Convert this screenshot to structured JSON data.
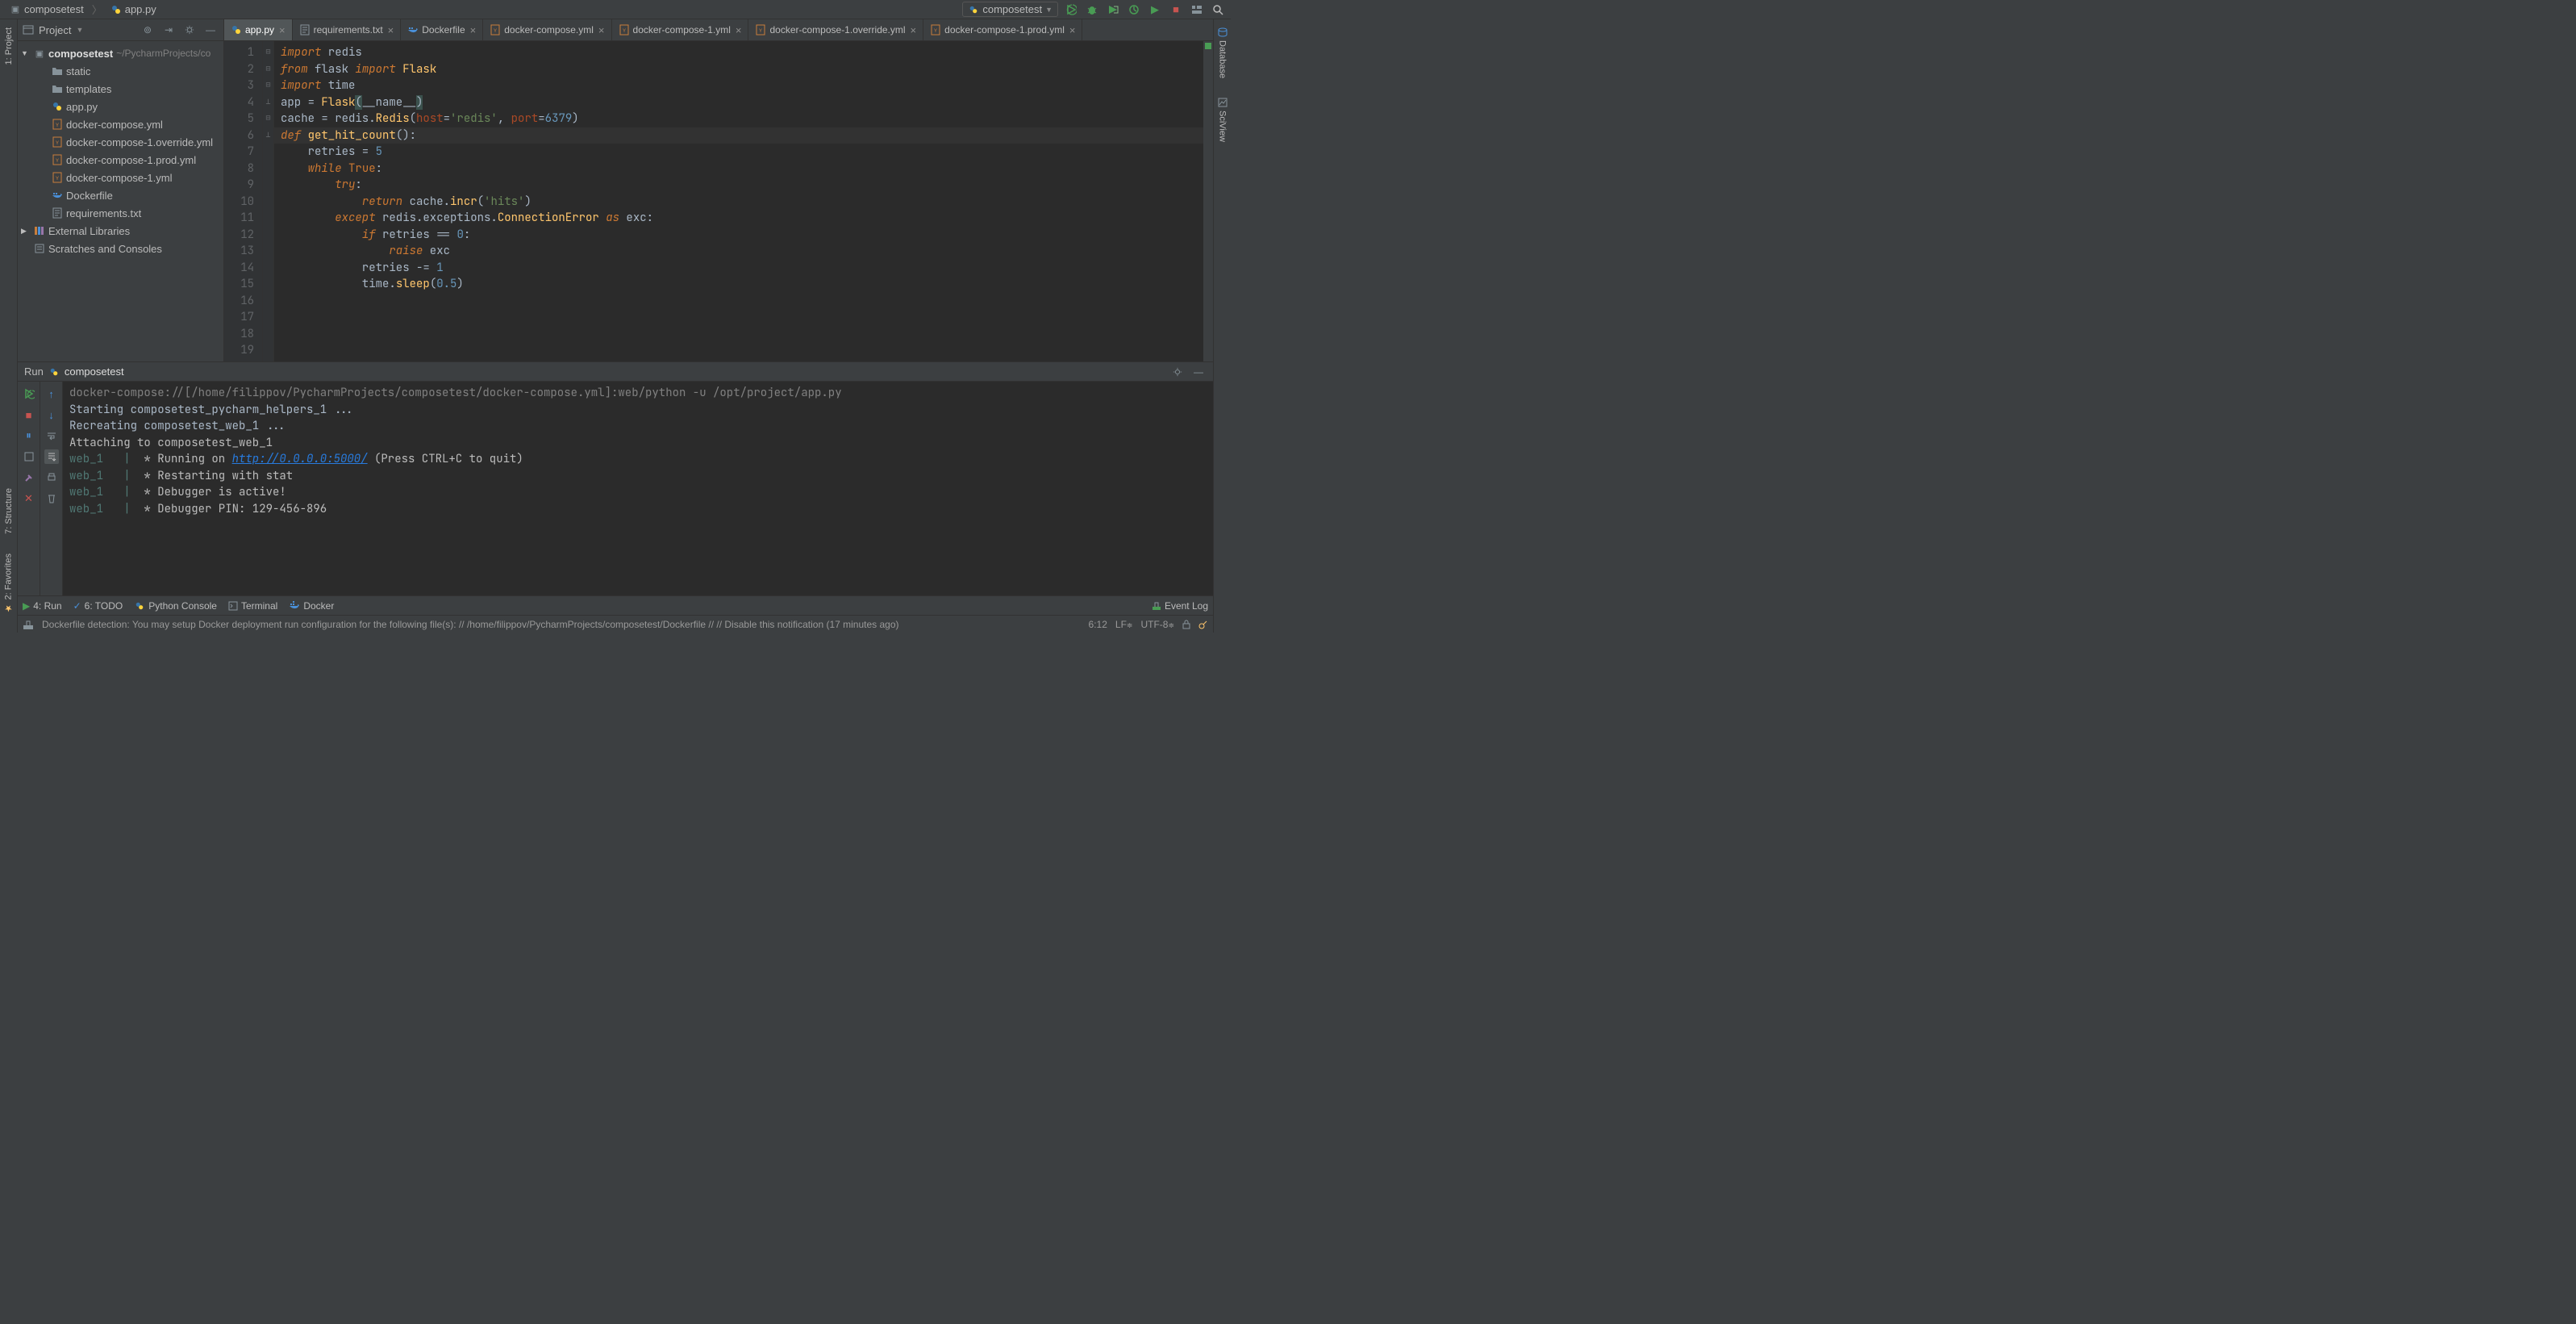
{
  "breadcrumb": {
    "project": "composetest",
    "file": "app.py"
  },
  "run_config_name": "composetest",
  "project_tool": {
    "title": "Project",
    "root": {
      "name": "composetest",
      "path": "~/PycharmProjects/co"
    },
    "items": [
      {
        "name": "static",
        "type": "folder"
      },
      {
        "name": "templates",
        "type": "folder"
      },
      {
        "name": "app.py",
        "type": "py"
      },
      {
        "name": "docker-compose.yml",
        "type": "yaml"
      },
      {
        "name": "docker-compose-1.override.yml",
        "type": "yaml"
      },
      {
        "name": "docker-compose-1.prod.yml",
        "type": "yaml"
      },
      {
        "name": "docker-compose-1.yml",
        "type": "yaml"
      },
      {
        "name": "Dockerfile",
        "type": "docker"
      },
      {
        "name": "requirements.txt",
        "type": "txt"
      }
    ],
    "external": "External Libraries",
    "scratches": "Scratches and Consoles"
  },
  "tabs": [
    {
      "label": "app.py",
      "type": "py",
      "active": true
    },
    {
      "label": "requirements.txt",
      "type": "txt"
    },
    {
      "label": "Dockerfile",
      "type": "docker"
    },
    {
      "label": "docker-compose.yml",
      "type": "yaml"
    },
    {
      "label": "docker-compose-1.yml",
      "type": "yaml"
    },
    {
      "label": "docker-compose-1.override.yml",
      "type": "yaml"
    },
    {
      "label": "docker-compose-1.prod.yml",
      "type": "yaml"
    }
  ],
  "editor": {
    "current_line": 6,
    "lines": [
      "import redis",
      "from flask import Flask",
      "import time",
      "",
      "",
      "app = Flask(__name__)",
      "cache = redis.Redis(host='redis', port=6379)",
      "",
      "",
      "def get_hit_count():",
      "    retries = 5",
      "    while True:",
      "        try:",
      "            return cache.incr('hits')",
      "        except redis.exceptions.ConnectionError as exc:",
      "            if retries == 0:",
      "                raise exc",
      "            retries -= 1",
      "            time.sleep(0.5)",
      ""
    ]
  },
  "run": {
    "title": "Run",
    "config": "composetest",
    "lines": [
      "docker-compose://[/home/filippov/PycharmProjects/composetest/docker-compose.yml]:web/python -u /opt/project/app.py",
      "Starting composetest_pycharm_helpers_1 ...",
      "Recreating composetest_web_1 ...",
      "Attaching to composetest_web_1",
      "web_1   |  * Running on http://0.0.0.0:5000/ (Press CTRL+C to quit)",
      "web_1   |  * Restarting with stat",
      "web_1   |  * Debugger is active!",
      "web_1   |  * Debugger PIN: 129-456-896"
    ]
  },
  "bottom_tools": {
    "run": "4: Run",
    "todo": "6: TODO",
    "pyconsole": "Python Console",
    "terminal": "Terminal",
    "docker": "Docker",
    "eventlog": "Event Log"
  },
  "left_tools": {
    "project": "1: Project",
    "structure": "7: Structure",
    "favorites": "2: Favorites"
  },
  "right_tools": {
    "database": "Database",
    "sciview": "SciView"
  },
  "status": {
    "notification": "Dockerfile detection: You may setup Docker deployment run configuration for the following file(s): // /home/filippov/PycharmProjects/composetest/Dockerfile // // Disable this notification (17 minutes ago)",
    "pos": "6:12",
    "sep": "LF",
    "enc": "UTF-8"
  }
}
